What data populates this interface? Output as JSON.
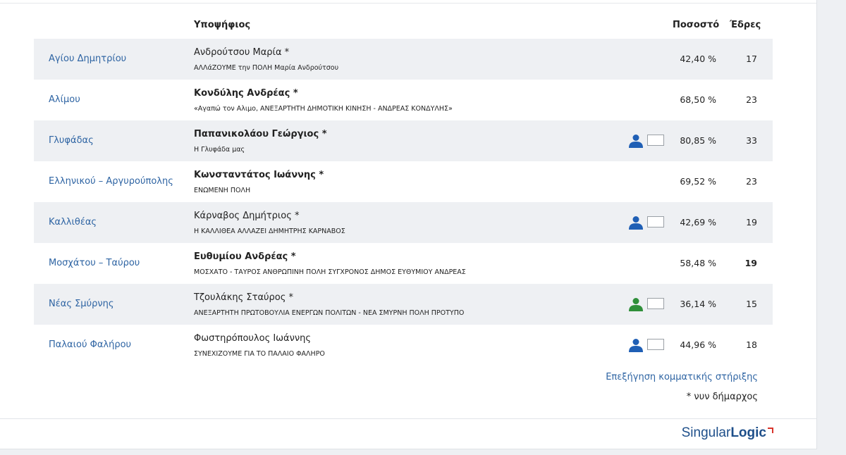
{
  "columns": {
    "candidate": "Υποψήφιος",
    "percentage": "Ποσοστό",
    "seats": "Έδρες"
  },
  "colors": {
    "link": "#2e64a3",
    "support_blue": "#1f5fb5",
    "support_green": "#2f8f3a",
    "logo": "#1e4f8a",
    "logo_mark": "#d9342b"
  },
  "rows": [
    {
      "municipality": "Αγίου Δημητρίου",
      "candidate": "Ανδρούτσου Μαρία *",
      "party": "ΑΛΛάΖΟΥΜΕ την ΠΟΛΗ Μαρία Ανδρούτσου",
      "percentage": "42,40 %",
      "seats": "17",
      "support_icon": ""
    },
    {
      "municipality": "Αλίμου",
      "candidate": "Κονδύλης Ανδρέας *",
      "party": "«Αγαπώ τον Αλιμο, ΑΝΕΞΑΡΤΗΤΗ ΔΗΜΟΤΙΚΗ ΚΙΝΗΣΗ - ΑΝΔΡΕΑΣ ΚΟΝΔΥΛΗΣ»",
      "percentage": "68,50 %",
      "seats": "23",
      "support_icon": ""
    },
    {
      "municipality": "Γλυφάδας",
      "candidate": "Παπανικολάου Γεώργιος *",
      "party": "Η Γλυφάδα μας",
      "percentage": "80,85 %",
      "seats": "33",
      "support_icon": "person-blue"
    },
    {
      "municipality": "Ελληνικού – Αργυρούπολης",
      "candidate": "Κωνσταντάτος Ιωάννης *",
      "party": "ΕΝΩΜΕΝΗ ΠΟΛΗ",
      "percentage": "69,52 %",
      "seats": "23",
      "support_icon": ""
    },
    {
      "municipality": "Καλλιθέας",
      "candidate": "Κάρναβος Δημήτριος *",
      "party": "Η ΚΑΛΛΙΘΕΑ ΑΛΛΑΖΕΙ ΔΗΜΗΤΡΗΣ ΚΑΡΝΑΒΟΣ",
      "percentage": "42,69 %",
      "seats": "19",
      "support_icon": "person-blue"
    },
    {
      "municipality": "Μοσχάτου – Ταύρου",
      "candidate": "Ευθυμίου Ανδρέας *",
      "party": "ΜΟΣΧΑΤΟ - ΤΑΥΡΟΣ ΑΝΘΡΩΠΙΝΗ ΠΟΛΗ ΣΥΓΧΡΟΝΟΣ ΔΗΜΟΣ ΕΥΘΥΜΙΟΥ ΑΝΔΡΕΑΣ",
      "percentage": "58,48 %",
      "seats": "19",
      "support_icon": ""
    },
    {
      "municipality": "Νέας Σμύρνης",
      "candidate": "Τζουλάκης Σταύρος *",
      "party": "ΑΝΕΞΑΡΤΗΤΗ ΠΡΩΤΟΒΟΥΛΙΑ ΕΝΕΡΓΩΝ ΠΟΛΙΤΩΝ - ΝΕΑ ΣΜΥΡΝΗ ΠΟΛΗ ΠΡΟΤΥΠΟ",
      "percentage": "36,14 %",
      "seats": "15",
      "support_icon": "person-green"
    },
    {
      "municipality": "Παλαιού Φαλήρου",
      "candidate": "Φωστηρόπουλος Ιωάννης",
      "party": "ΣΥΝΕΧΙΖΟΥΜΕ ΓΙΑ ΤΟ ΠΑΛΑΙΟ ΦΑΛΗΡΟ",
      "percentage": "44,96 %",
      "seats": "18",
      "support_icon": "person-blue"
    }
  ],
  "explain_link": "Επεξήγηση κομματικής στήριξης",
  "note": "* νυν δήμαρχος",
  "logo": {
    "part1": "Singular",
    "part2": "Logic"
  }
}
